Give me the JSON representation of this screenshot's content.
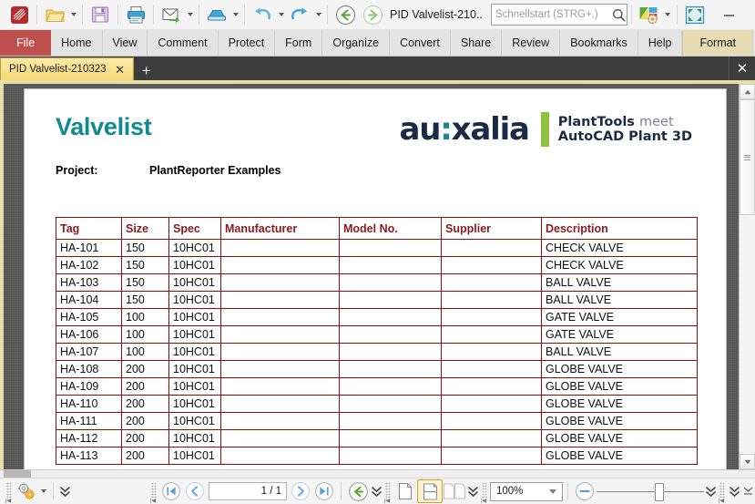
{
  "window": {
    "document_title": "PID Valvelist-210..",
    "search_placeholder": "Schnellstart (STRG+.)",
    "minimize": "—",
    "maximize": "□",
    "close": "✕"
  },
  "quick_access": {
    "app_icon": "app-logo",
    "items": [
      {
        "name": "open-file-button",
        "icon": "folder-open-icon",
        "caret": true
      },
      {
        "name": "save-button",
        "icon": "floppy-disk-icon",
        "caret": false
      },
      {
        "name": "print-button",
        "icon": "printer-icon",
        "caret": false
      },
      {
        "name": "email-button",
        "icon": "envelope-send-icon",
        "caret": true
      },
      {
        "name": "scan-button",
        "icon": "scanner-icon",
        "caret": true
      },
      {
        "name": "undo-button",
        "icon": "undo-arrow-icon",
        "caret": true
      },
      {
        "name": "redo-button",
        "icon": "redo-arrow-icon",
        "caret": true
      },
      {
        "name": "back-button",
        "icon": "back-circle-icon",
        "caret": false
      },
      {
        "name": "forward-button",
        "icon": "forward-circle-icon",
        "caret": false
      }
    ],
    "settings": {
      "name": "app-settings-button",
      "icon": "palette-gear-icon",
      "caret": true
    },
    "fullscreen": {
      "name": "fullscreen-button",
      "icon": "expand-arrows-icon"
    }
  },
  "ribbon": {
    "tabs": [
      {
        "label": "File",
        "key": "file",
        "active": false
      },
      {
        "label": "Home",
        "key": "home",
        "active": false
      },
      {
        "label": "View",
        "key": "view",
        "active": false
      },
      {
        "label": "Comment",
        "key": "comment",
        "active": false
      },
      {
        "label": "Protect",
        "key": "protect",
        "active": false
      },
      {
        "label": "Form",
        "key": "form",
        "active": false
      },
      {
        "label": "Organize",
        "key": "organize",
        "active": false
      },
      {
        "label": "Convert",
        "key": "convert",
        "active": false
      },
      {
        "label": "Share",
        "key": "share",
        "active": false
      },
      {
        "label": "Review",
        "key": "review",
        "active": false
      },
      {
        "label": "Bookmarks",
        "key": "bookmarks",
        "active": false
      },
      {
        "label": "Help",
        "key": "help",
        "active": false
      },
      {
        "label": "Format",
        "key": "format",
        "active": true
      }
    ],
    "right_icons": [
      {
        "name": "find-in-document-icon"
      },
      {
        "name": "find-in-folder-icon"
      }
    ],
    "expand_icon": "chevron-down-icon"
  },
  "tabstrip": {
    "tabs": [
      {
        "label": "PID Valvelist-210323",
        "close": "✕"
      }
    ],
    "new_tab": "+",
    "close_all": "✕"
  },
  "document": {
    "title": "Valvelist",
    "project_label": "Project:",
    "project_value": "PlantReporter Examples",
    "logo": {
      "brand_left": "au",
      "brand_colon": ":",
      "brand_right": "xalia",
      "tagline_line1_bold": "PlantTools",
      "tagline_line1_light": "meet",
      "tagline_line2": "AutoCAD Plant 3D",
      "accent_green": "#8fc23f",
      "navy": "#1b2b45",
      "teal": "#13888d"
    },
    "table": {
      "columns": [
        "Tag",
        "Size",
        "Spec",
        "Manufacturer",
        "Model No.",
        "Supplier",
        "Description"
      ],
      "header_color": "#8b1a1a",
      "border_color": "#8b0f0f",
      "rows": [
        [
          "HA-101",
          "150",
          "10HC01",
          "",
          "",
          "",
          "CHECK VALVE"
        ],
        [
          "HA-102",
          "150",
          "10HC01",
          "",
          "",
          "",
          "CHECK VALVE"
        ],
        [
          "HA-103",
          "150",
          "10HC01",
          "",
          "",
          "",
          "BALL VALVE"
        ],
        [
          "HA-104",
          "150",
          "10HC01",
          "",
          "",
          "",
          "BALL VALVE"
        ],
        [
          "HA-105",
          "100",
          "10HC01",
          "",
          "",
          "",
          "GATE VALVE"
        ],
        [
          "HA-106",
          "100",
          "10HC01",
          "",
          "",
          "",
          "GATE VALVE"
        ],
        [
          "HA-107",
          "100",
          "10HC01",
          "",
          "",
          "",
          "BALL VALVE"
        ],
        [
          "HA-108",
          "200",
          "10HC01",
          "",
          "",
          "",
          "GLOBE VALVE"
        ],
        [
          "HA-109",
          "200",
          "10HC01",
          "",
          "",
          "",
          "GLOBE VALVE"
        ],
        [
          "HA-110",
          "200",
          "10HC01",
          "",
          "",
          "",
          "GLOBE VALVE"
        ],
        [
          "HA-111",
          "200",
          "10HC01",
          "",
          "",
          "",
          "GLOBE VALVE"
        ],
        [
          "HA-112",
          "200",
          "10HC01",
          "",
          "",
          "",
          "GLOBE VALVE"
        ],
        [
          "HA-113",
          "200",
          "10HC01",
          "",
          "",
          "",
          "GLOBE VALVE"
        ]
      ]
    }
  },
  "statusbar": {
    "tools_icon": "gears-icon",
    "page_indicator": "1 / 1",
    "page_current": "1",
    "page_total": "1",
    "first_page_icon": "first-page-icon",
    "prev_page_icon": "prev-page-icon",
    "next_page_icon": "next-page-icon",
    "last_page_icon": "last-page-icon",
    "back_view_icon": "back-view-icon",
    "single_page_icon": "single-page-icon",
    "continuous_page_icon": "continuous-page-icon",
    "facing_page_icon": "facing-page-icon",
    "zoom_value": "100%",
    "zoom_out_icon": "zoom-out-icon"
  }
}
